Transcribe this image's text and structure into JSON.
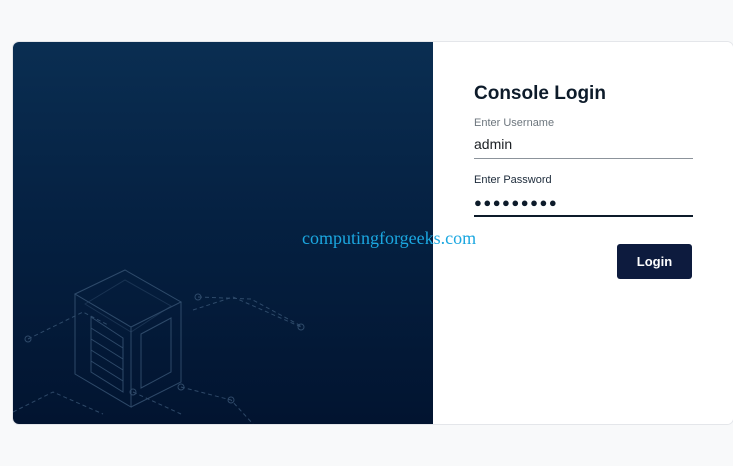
{
  "login": {
    "title": "Console Login",
    "username_label": "Enter Username",
    "username_value": "admin",
    "password_label": "Enter Password",
    "password_mask": "●●●●●●●●●",
    "button_label": "Login"
  },
  "watermark": "computingforgeeks.com",
  "colors": {
    "panel_dark": "#021430",
    "button": "#0d1b3e",
    "watermark": "#1ba7e0"
  }
}
